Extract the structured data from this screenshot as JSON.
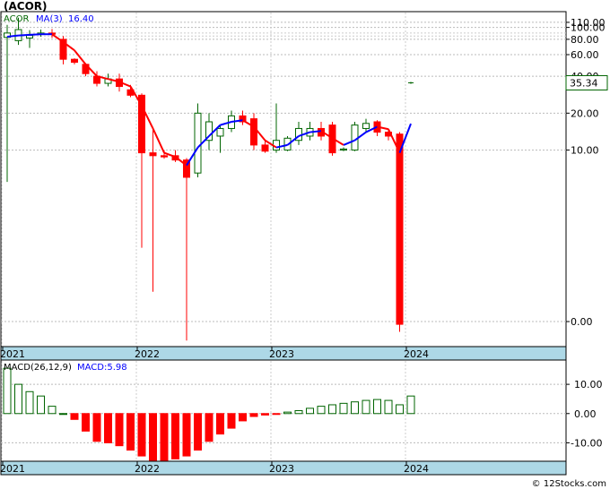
{
  "title": "(ACOR)",
  "footer": "© 12Stocks.com",
  "colors": {
    "up": "#006400",
    "down": "#ff0000",
    "ma_down": "#ff0000",
    "ma_up": "#0000ff",
    "axis_band": "#add8e6",
    "price_box": "#006400",
    "macd_pos": "#006400",
    "macd_neg": "#ff0000"
  },
  "chart_data": [
    {
      "type": "candlestick",
      "legend": {
        "symbol": "ACOR",
        "ma_label": "MA(3)",
        "ma_value": "16.40",
        "placement": "top-left"
      },
      "scale": "log",
      "y_ticks": [
        "110.00",
        "100.00",
        "80.00",
        "60.00",
        "40.00",
        "20.00",
        "10.00",
        "0.00"
      ],
      "y_tick_values": [
        110,
        100,
        80,
        60,
        40,
        20,
        10,
        0.4
      ],
      "last_price": "35.34",
      "last_price_value": 35.34,
      "x_labels": [
        "2021",
        "2022",
        "2023",
        "2024"
      ],
      "x_label_index": [
        0,
        12,
        24,
        36
      ],
      "candles": [
        {
          "o": 83,
          "h": 105,
          "l": 5.5,
          "c": 90
        },
        {
          "o": 78,
          "h": 120,
          "l": 72,
          "c": 96
        },
        {
          "o": 82,
          "h": 95,
          "l": 68,
          "c": 86
        },
        {
          "o": 88,
          "h": 96,
          "l": 84,
          "c": 90
        },
        {
          "o": 90,
          "h": 97,
          "l": 82,
          "c": 88
        },
        {
          "o": 80,
          "h": 85,
          "l": 50,
          "c": 55
        },
        {
          "o": 55,
          "h": 56,
          "l": 50,
          "c": 52
        },
        {
          "o": 50,
          "h": 51,
          "l": 40,
          "c": 42
        },
        {
          "o": 40,
          "h": 44,
          "l": 33,
          "c": 35
        },
        {
          "o": 35,
          "h": 42,
          "l": 33,
          "c": 38
        },
        {
          "o": 38,
          "h": 42,
          "l": 30,
          "c": 33
        },
        {
          "o": 31,
          "h": 34,
          "l": 27,
          "c": 28
        },
        {
          "o": 28,
          "h": 29,
          "l": 1.6,
          "c": 9.5
        },
        {
          "o": 9.5,
          "h": 15,
          "l": 0.7,
          "c": 9.0
        },
        {
          "o": 9.0,
          "h": 10,
          "l": 8.5,
          "c": 8.8
        },
        {
          "o": 9.0,
          "h": 10,
          "l": 8.0,
          "c": 8.3
        },
        {
          "o": 8.3,
          "h": 8.6,
          "l": 0.28,
          "c": 6.0
        },
        {
          "o": 6.5,
          "h": 24,
          "l": 6.0,
          "c": 20
        },
        {
          "o": 12,
          "h": 20,
          "l": 10,
          "c": 17
        },
        {
          "o": 13,
          "h": 16,
          "l": 9.5,
          "c": 15
        },
        {
          "o": 15,
          "h": 21,
          "l": 14,
          "c": 19
        },
        {
          "o": 19,
          "h": 21,
          "l": 16,
          "c": 17
        },
        {
          "o": 18,
          "h": 20,
          "l": 10,
          "c": 11
        },
        {
          "o": 11,
          "h": 12,
          "l": 9.5,
          "c": 9.8
        },
        {
          "o": 10,
          "h": 24,
          "l": 9.5,
          "c": 12
        },
        {
          "o": 10,
          "h": 13,
          "l": 9.8,
          "c": 12.5
        },
        {
          "o": 12,
          "h": 17,
          "l": 11,
          "c": 15
        },
        {
          "o": 13,
          "h": 17,
          "l": 12,
          "c": 15
        },
        {
          "o": 15,
          "h": 17,
          "l": 12,
          "c": 13
        },
        {
          "o": 16,
          "h": 17,
          "l": 9.0,
          "c": 9.5
        },
        {
          "o": 10,
          "h": 10.5,
          "l": 9.8,
          "c": 10.2
        },
        {
          "o": 10,
          "h": 17,
          "l": 9.8,
          "c": 16
        },
        {
          "o": 15,
          "h": 18,
          "l": 14,
          "c": 16.5
        },
        {
          "o": 17,
          "h": 17.5,
          "l": 13,
          "c": 14
        },
        {
          "o": 14,
          "h": 15,
          "l": 12,
          "c": 13
        },
        {
          "o": 13.5,
          "h": 14,
          "l": 0.33,
          "c": 0.38
        },
        {
          "o": 35.34,
          "h": 36,
          "l": 34.7,
          "c": 35.34
        }
      ],
      "ma": [
        84,
        86,
        87,
        88,
        88,
        76,
        65,
        50,
        40,
        38,
        36,
        33,
        23,
        15,
        9.5,
        8.8,
        7.5,
        10.5,
        13,
        16,
        17,
        17.5,
        15.5,
        12,
        10.5,
        11,
        13,
        14,
        14.3,
        12.5,
        11,
        12,
        14,
        15.5,
        14.8,
        9.5,
        16.4
      ]
    },
    {
      "type": "bar",
      "legend": {
        "label": "MACD(26,12,9)",
        "value_label": "MACD:5.98",
        "placement": "top-left"
      },
      "y_ticks": [
        "10.00",
        "0.00",
        "-10.00"
      ],
      "y_tick_values": [
        10,
        0,
        -10
      ],
      "ylim": [
        -16,
        18
      ],
      "x_labels": [
        "2021",
        "2022",
        "2023",
        "2024"
      ],
      "x_label_index": [
        0,
        12,
        24,
        36
      ],
      "values": [
        15.5,
        10.0,
        7.5,
        6.0,
        2.5,
        0.0,
        -2.0,
        -6.0,
        -9.5,
        -10.0,
        -11.0,
        -12.5,
        -14.5,
        -16.0,
        -16.0,
        -15.5,
        -14.5,
        -12.5,
        -9.5,
        -7.0,
        -5.0,
        -2.5,
        -1.0,
        -0.5,
        -0.3,
        0.5,
        1.0,
        1.8,
        2.5,
        3.0,
        3.5,
        4.0,
        4.5,
        4.8,
        4.5,
        3.0,
        6.0
      ]
    }
  ]
}
